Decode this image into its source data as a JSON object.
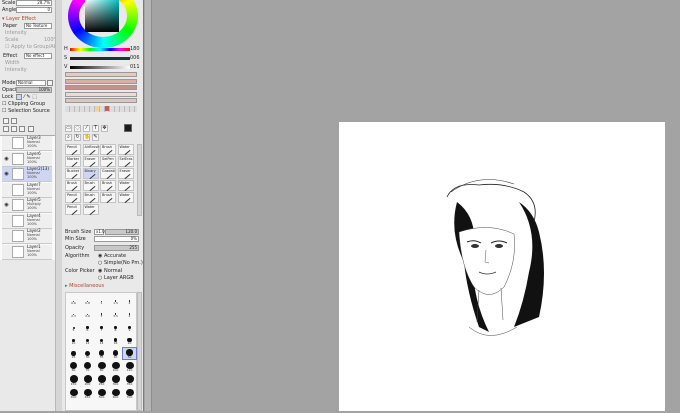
{
  "brush_top": {
    "scale_label": "Scale",
    "scale_value": "28.7%",
    "angle_label": "Angle",
    "angle_value": "0"
  },
  "layer_effect": {
    "header": "Layer Effect",
    "paper_label": "Paper",
    "paper_value": "No Texture",
    "intensity_label": "Intensity",
    "scale_label": "Scale",
    "scale_value": "100%",
    "apply_label": "Apply to Group/At",
    "effect_label": "Effect",
    "effect_value": "No effect",
    "width_label": "Width",
    "intensity2_label": "Intensity"
  },
  "layer_props": {
    "mode_label": "Mode",
    "mode_value": "Normal",
    "opacity_label": "Opacity",
    "opacity_value": "100%",
    "lock_label": "Lock",
    "clipping_label": "Clipping Group",
    "selection_source_label": "Selection Source"
  },
  "layers": [
    {
      "name": "Layer3",
      "mode": "Normal",
      "opacity": "100%",
      "selected": false,
      "visible": false
    },
    {
      "name": "Layer6",
      "mode": "Normal",
      "opacity": "100%",
      "selected": false,
      "visible": true
    },
    {
      "name": "Layer2(13)",
      "mode": "Normal",
      "opacity": "100%",
      "selected": true,
      "visible": true
    },
    {
      "name": "Layer7",
      "mode": "Normal",
      "opacity": "100%",
      "selected": false,
      "visible": false
    },
    {
      "name": "Layer5",
      "mode": "Multiply",
      "opacity": "100%",
      "selected": false,
      "visible": true
    },
    {
      "name": "Layer4",
      "mode": "Normal",
      "opacity": "100%",
      "selected": false,
      "visible": false
    },
    {
      "name": "Layer2",
      "mode": "Normal",
      "opacity": "100%",
      "selected": false,
      "visible": false
    },
    {
      "name": "Layer1",
      "mode": "Normal",
      "opacity": "100%",
      "selected": false,
      "visible": false
    }
  ],
  "color": {
    "h_label": "H",
    "h_value": "180",
    "s_label": "S",
    "s_value": "006",
    "v_label": "V",
    "v_value": "011",
    "current_color": "#1c1c1c",
    "swatches": [
      "#e8c9c1",
      "#d9b0a6",
      "#c88f87",
      "#eed9d4",
      "#d8c7c3"
    ]
  },
  "tools": [
    "Pencil",
    "AirBrush",
    "Brush",
    "Water",
    "Marker",
    "Eraser",
    "SelPen",
    "SelEras",
    "Bucket",
    "Binary",
    "Gradati",
    "Eraser",
    "Brush",
    "Brush",
    "Brush",
    "Water",
    "Pencil",
    "Brush",
    "Brush",
    "Water",
    "Pencil",
    "Water"
  ],
  "brush_settings": {
    "brush_size_label": "Brush Size",
    "brush_size_mult": "x1.0",
    "brush_size_value": "120.0",
    "min_size_label": "Min Size",
    "min_size_value": "0%",
    "density_label": "Opacity",
    "density_value": "255",
    "algorithm_label": "Algorithm",
    "algo_opt1": "Accurate",
    "algo_opt2": "Simple(No Pm.)",
    "color_picker_label": "Color Picker",
    "picker_opt1": "Normal",
    "picker_opt2": "Layer ARGB",
    "misc_label": "Miscellaneous"
  },
  "brush_sizes": [
    "0.6",
    "0.8",
    "1",
    "1.5",
    "2",
    "2.3",
    "2.6",
    "3",
    "3.5",
    "4",
    "5",
    "6",
    "7",
    "8",
    "9",
    "10",
    "12",
    "14",
    "16",
    "20",
    "25",
    "30",
    "35",
    "40",
    "50",
    "60",
    "70",
    "80",
    "100",
    "120",
    "150",
    "200",
    "250",
    "300",
    "350",
    "400",
    "450",
    "500",
    "600",
    "700"
  ]
}
